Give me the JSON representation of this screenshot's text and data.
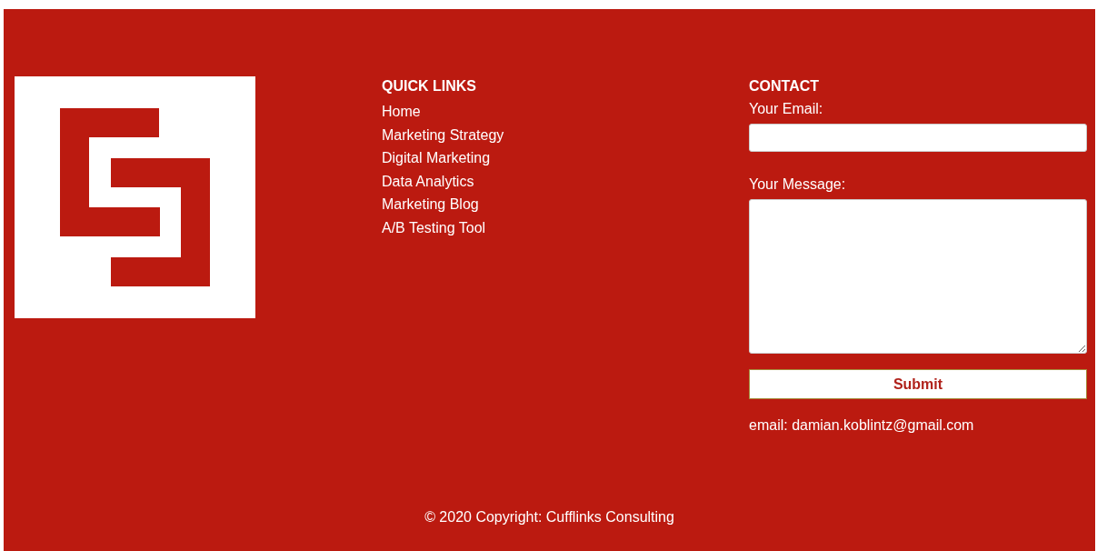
{
  "quick_links": {
    "title": "QUICK LINKS",
    "items": [
      "Home",
      "Marketing Strategy",
      "Digital Marketing",
      "Data Analytics",
      "Marketing Blog",
      "A/B Testing Tool"
    ]
  },
  "contact": {
    "title": "CONTACT",
    "email_label": "Your Email:",
    "message_label": "Your Message:",
    "submit": "Submit",
    "email_note": "email: damian.koblintz@gmail.com"
  },
  "copyright": "© 2020 Copyright: Cufflinks Consulting"
}
